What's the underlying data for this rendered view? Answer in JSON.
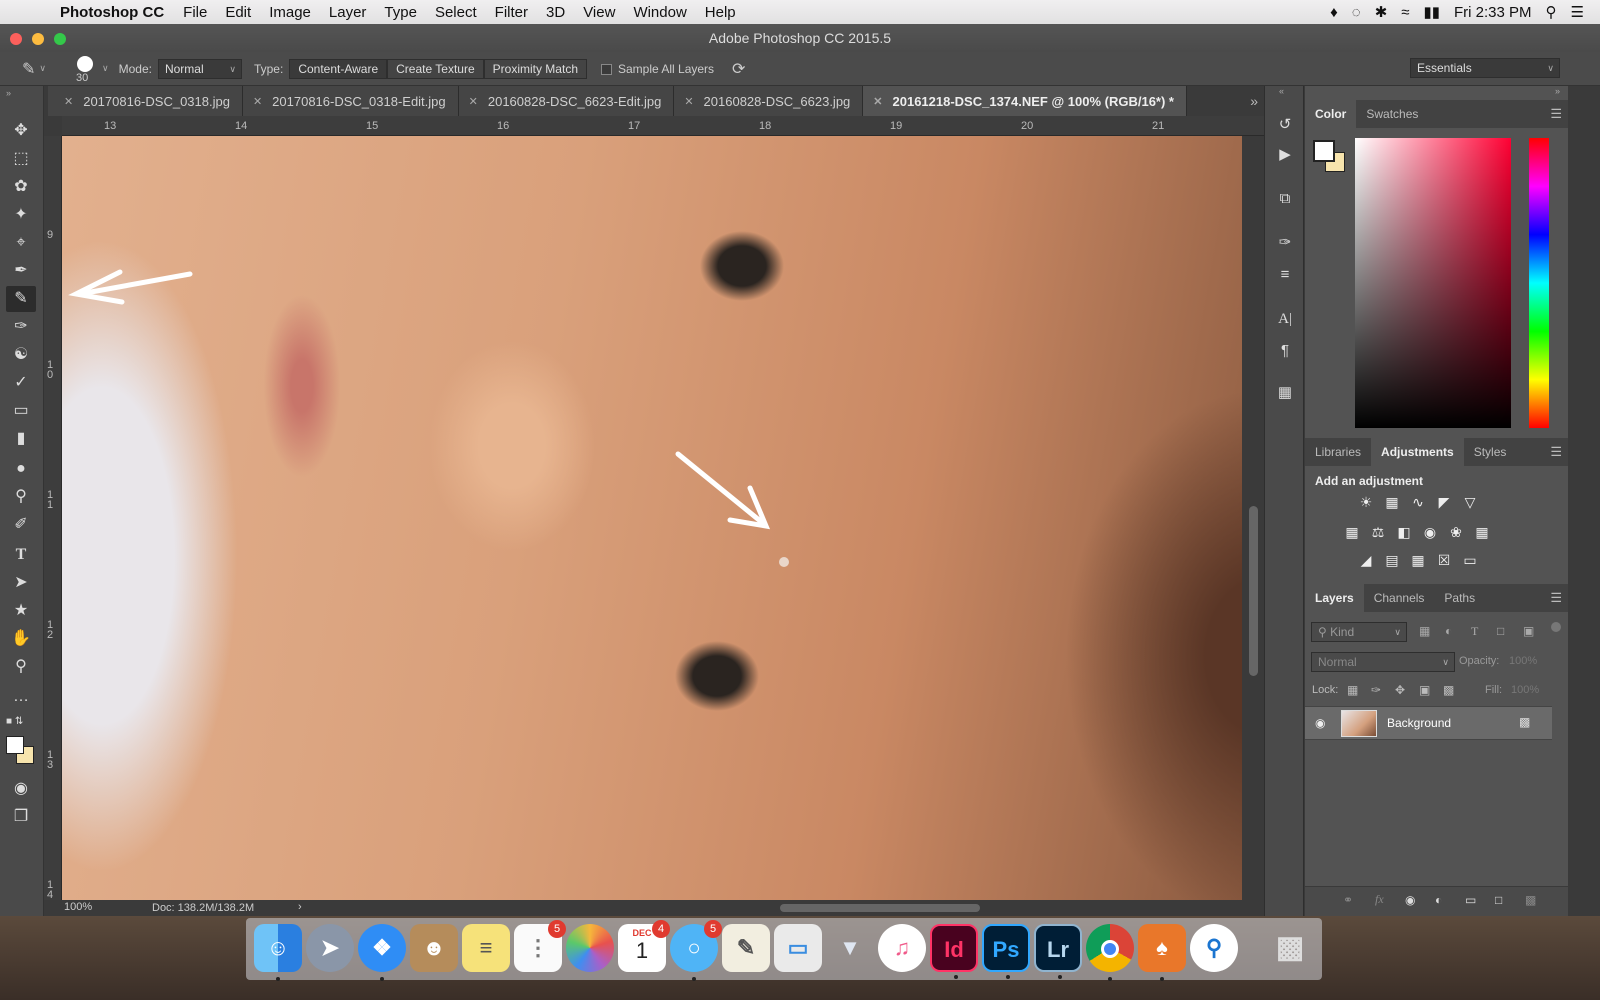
{
  "menubar": {
    "app_name": "Photoshop CC",
    "items": [
      "File",
      "Edit",
      "Image",
      "Layer",
      "Type",
      "Select",
      "Filter",
      "3D",
      "View",
      "Window",
      "Help"
    ],
    "clock": "Fri 2:33 PM"
  },
  "window": {
    "title": "Adobe Photoshop CC 2015.5"
  },
  "options": {
    "brush_size": "30",
    "mode_label": "Mode:",
    "mode_value": "Normal",
    "type_label": "Type:",
    "type_buttons": [
      "Content-Aware",
      "Create Texture",
      "Proximity Match"
    ],
    "sample_all_layers": "Sample All Layers",
    "workspace": "Essentials"
  },
  "tabs": [
    "20170816-DSC_0318.jpg",
    "20170816-DSC_0318-Edit.jpg",
    "20160828-DSC_6623-Edit.jpg",
    "20160828-DSC_6623.jpg",
    "20161218-DSC_1374.NEF @ 100% (RGB/16*) *"
  ],
  "ruler": {
    "h_ticks": [
      "13",
      "14",
      "15",
      "16",
      "17",
      "18",
      "19",
      "20",
      "21"
    ],
    "v_ticks": [
      "9",
      "1\n0",
      "1\n1",
      "1\n2",
      "1\n3",
      "1\n4"
    ]
  },
  "status": {
    "zoom": "100%",
    "doc": "Doc: 138.2M/138.2M"
  },
  "color_panel": {
    "tabs": [
      "Color",
      "Swatches"
    ]
  },
  "adjustments_panel": {
    "tabs": [
      "Libraries",
      "Adjustments",
      "Styles"
    ],
    "heading": "Add an adjustment"
  },
  "layers_panel": {
    "tabs": [
      "Layers",
      "Channels",
      "Paths"
    ],
    "filter_kind": "Kind",
    "blend_mode": "Normal",
    "opacity_label": "Opacity:",
    "opacity_value": "100%",
    "lock_label": "Lock:",
    "fill_label": "Fill:",
    "fill_value": "100%",
    "layer_name": "Background"
  },
  "dock": {
    "reminders_badge": "5",
    "calendar_month": "DEC",
    "calendar_day": "1",
    "calendar_badge": "4",
    "messages_badge": "5",
    "app_labels": {
      "indesign": "Id",
      "photoshop": "Ps",
      "lightroom": "Lr"
    }
  },
  "colors": {
    "accent_red": "#e03a2f",
    "panel_bg": "#535353",
    "ps_blue": "#31a8ff",
    "id_pink": "#ff3366",
    "lr_blue": "#31a8ff"
  }
}
